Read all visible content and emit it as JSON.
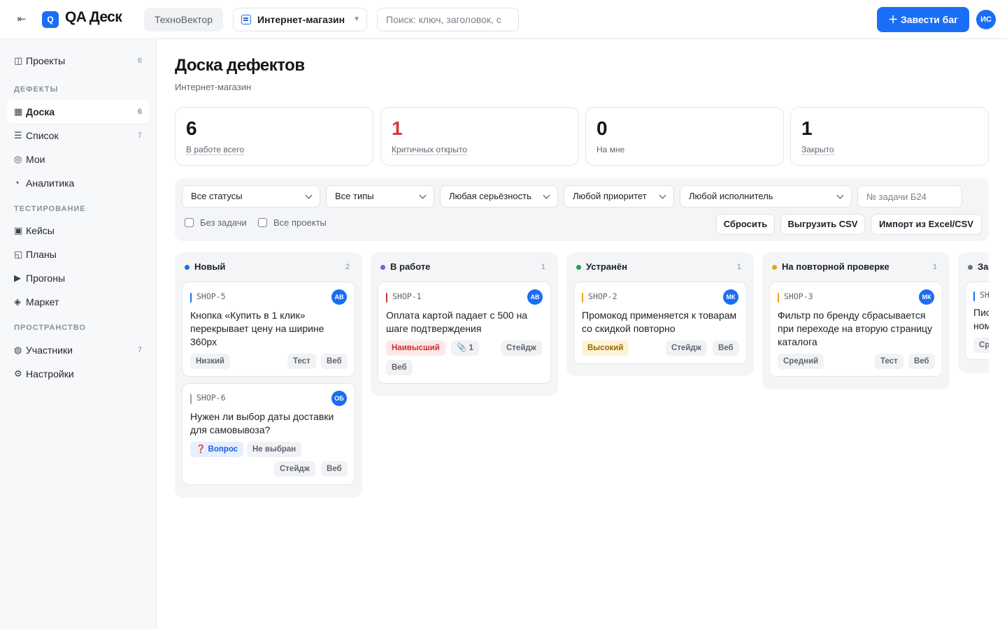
{
  "topbar": {
    "collapse_icon": "⇤",
    "logo_badge": "Q",
    "logo_text": "QA Деск",
    "org": "ТехноВектор",
    "project": "Интернет-магазин",
    "project_arrow": "▼",
    "search_placeholder": "Поиск: ключ, заголовок, с",
    "new_bug": "＋  Завести баг",
    "user_initials": "ИС"
  },
  "sidebar": {
    "projects": {
      "icon": "◫",
      "label": "Проекты",
      "count": "6"
    },
    "section_defects": "ДЕФЕКТЫ",
    "defects": [
      {
        "icon": "▦",
        "label": "Доска",
        "count": "6"
      },
      {
        "icon": "☰",
        "label": "Список",
        "count": "7"
      },
      {
        "icon": "◎",
        "label": "Мои",
        "count": ""
      },
      {
        "icon": "◔",
        "label": "Аналитика",
        "count": ""
      }
    ],
    "section_testing": "ТЕСТИРОВАНИЕ",
    "testing": [
      {
        "icon": "▣",
        "label": "Кейсы"
      },
      {
        "icon": "◱",
        "label": "Планы"
      },
      {
        "icon": "▶",
        "label": "Прогоны"
      },
      {
        "icon": "◈",
        "label": "Маркет"
      }
    ],
    "section_space": "ПРОСТРАНСТВО",
    "space": [
      {
        "icon": "◍",
        "label": "Участники",
        "count": "7"
      },
      {
        "icon": "⚙",
        "label": "Настройки",
        "count": ""
      }
    ]
  },
  "page": {
    "title": "Доска дефектов",
    "subtitle": "Интернет-магазин"
  },
  "stats": [
    {
      "value": "6",
      "label": "В работе всего"
    },
    {
      "value": "1",
      "label": "Критичных открыто"
    },
    {
      "value": "0",
      "label": "На мне"
    },
    {
      "value": "1",
      "label": "Закрыто"
    }
  ],
  "filters": {
    "status": "Все статусы",
    "type": "Все типы",
    "severity": "Любая серьёзность",
    "priority": "Любой приоритет",
    "assignee": "Любой исполнитель",
    "task_placeholder": "№ задачи Б24",
    "no_task": "Без задачи",
    "all_projects": "Все проекты",
    "reset": "Сбросить",
    "export": "Выгрузить CSV",
    "import": "Импорт из Excel/CSV"
  },
  "colors": {
    "accent": "#1a6ef5",
    "new": "#1a6ef5",
    "in_progress": "#7b5cf0",
    "fixed": "#1fa35a",
    "retest": "#e8a317",
    "closed": "#6b7280",
    "critical": "#d23b3b"
  },
  "columns": [
    {
      "title": "Новый",
      "count": "2",
      "cards": [
        {
          "key": "SHOP-5",
          "avatar": "АВ",
          "title": "Кнопка «Купить в 1 клик» перекрывает цену на ширине 360px",
          "priority": "Низкий",
          "tags": [
            "Тест",
            "Веб"
          ]
        },
        {
          "key": "SHOP-6",
          "avatar": "ОБ",
          "title": "Нужен ли выбор даты доставки для самовывоза?",
          "type": "❓ Вопрос",
          "priority": "Не выбран",
          "tags": [
            "Стейдж",
            "Веб"
          ]
        }
      ]
    },
    {
      "title": "В работе",
      "count": "1",
      "cards": [
        {
          "key": "SHOP-1",
          "avatar": "АВ",
          "title": "Оплата картой падает с 500 на шаге подтверждения",
          "priority": "Наивысший",
          "attachments": "📎 1",
          "tags": [
            "Стейдж",
            "Веб"
          ]
        }
      ]
    },
    {
      "title": "Устранён",
      "count": "1",
      "cards": [
        {
          "key": "SHOP-2",
          "avatar": "МК",
          "title": "Промокод применяется к товарам со скидкой повторно",
          "priority": "Высокий",
          "tags": [
            "Стейдж",
            "Веб"
          ]
        }
      ]
    },
    {
      "title": "На повторной проверке",
      "count": "1",
      "cards": [
        {
          "key": "SHOP-3",
          "avatar": "МК",
          "title": "Фильтр по бренду сбрасывается при переходе на вторую страницу каталога",
          "priority": "Средний",
          "tags": [
            "Тест",
            "Веб"
          ]
        }
      ]
    },
    {
      "title": "За",
      "count": "",
      "cards": [
        {
          "key": "SH",
          "title": "Пис ном",
          "priority": "Ср"
        }
      ]
    }
  ]
}
